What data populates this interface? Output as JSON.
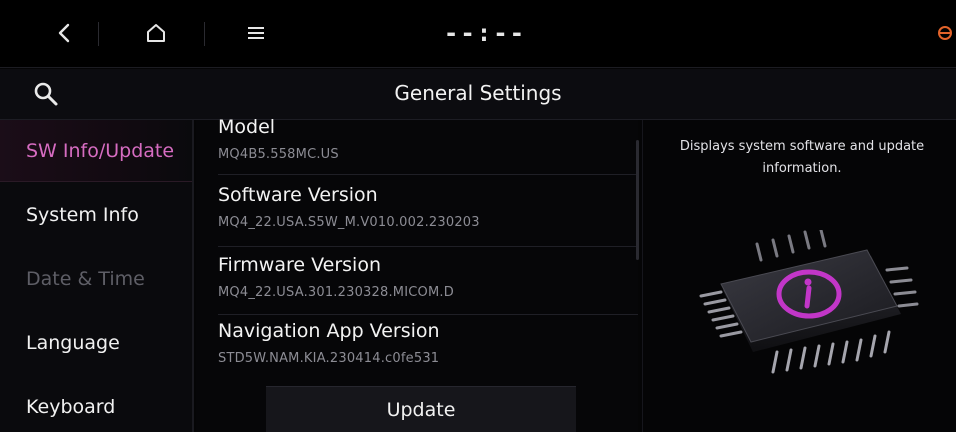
{
  "status_bar": {
    "back_icon": "chevron-left-icon",
    "home_icon": "home-icon",
    "menu_icon": "hamburger-menu-icon",
    "clock": "--:--",
    "status_icon": "no-signal-icon"
  },
  "header": {
    "search_icon": "search-icon",
    "title": "General Settings"
  },
  "sidebar": {
    "items": [
      {
        "label": "SW Info/Update",
        "state": "active"
      },
      {
        "label": "System Info",
        "state": "normal"
      },
      {
        "label": "Date & Time",
        "state": "disabled"
      },
      {
        "label": "Language",
        "state": "normal"
      },
      {
        "label": "Keyboard",
        "state": "normal"
      }
    ]
  },
  "main": {
    "items": [
      {
        "title": "Model",
        "value": "MQ4B5.558MC.US"
      },
      {
        "title": "Software Version",
        "value": "MQ4_22.USA.S5W_M.V010.002.230203"
      },
      {
        "title": "Firmware Version",
        "value": "MQ4_22.USA.301.230328.MICOM.D"
      },
      {
        "title": "Navigation App Version",
        "value": "STD5W.NAM.KIA.230414.c0fe531"
      }
    ],
    "update_label": "Update"
  },
  "info_panel": {
    "description": "Displays system software and update information.",
    "illustration_icon": "chip-info-icon"
  },
  "colors": {
    "accent": "#d66cc1",
    "background": "#050506",
    "disabled_text": "#5e5e66",
    "warning": "#e2632a"
  }
}
